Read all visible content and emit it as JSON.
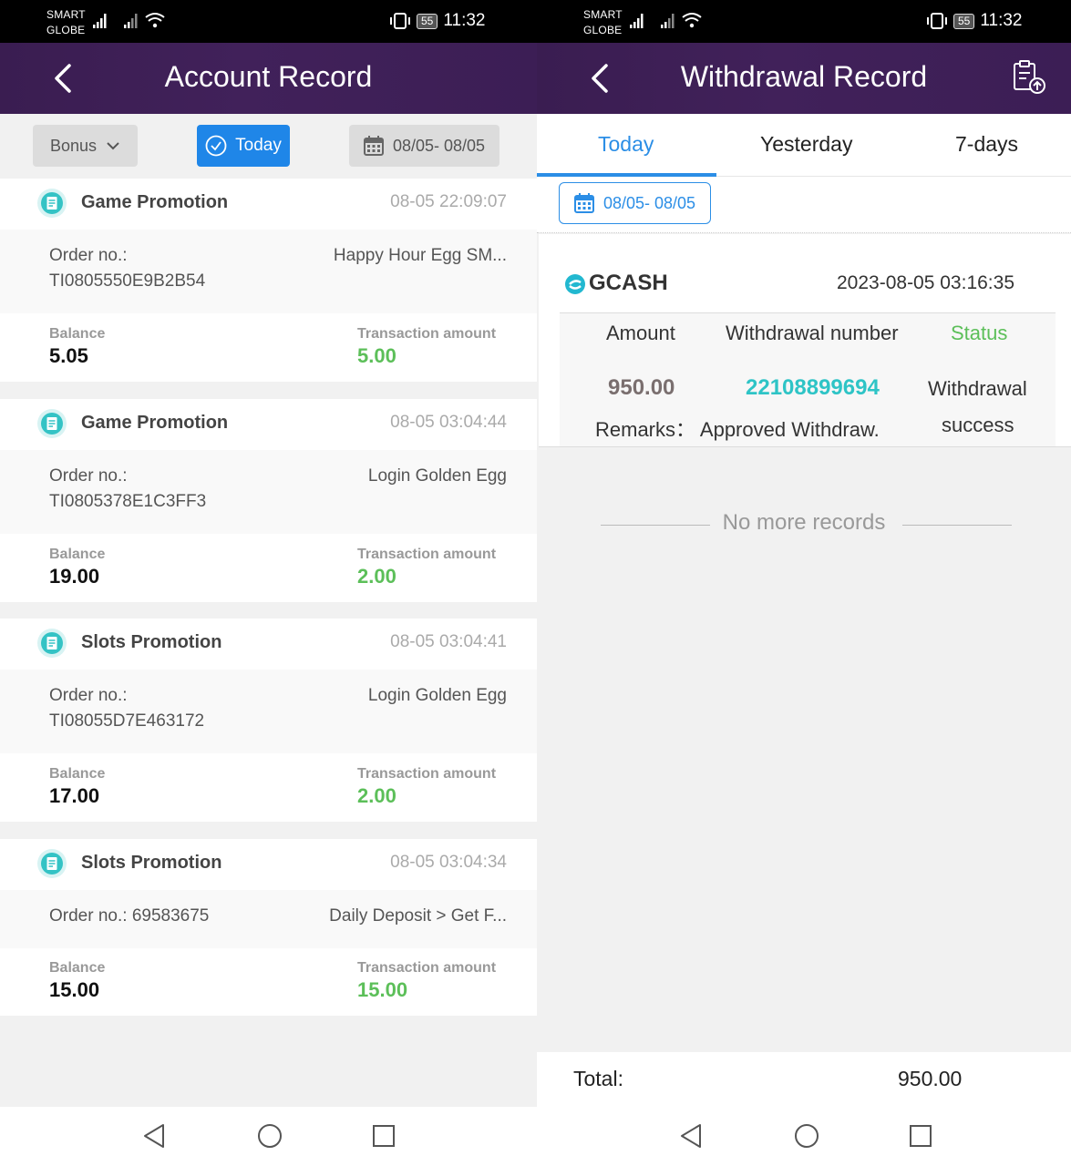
{
  "status_bar": {
    "carrier_line1": "SMART",
    "carrier_line2": "GLOBE",
    "battery": "55",
    "time": "11:32"
  },
  "left": {
    "header_title": "Account Record",
    "filter": {
      "type_label": "Bonus",
      "today_label": "Today",
      "date_range": "08/05- 08/05"
    },
    "records": [
      {
        "title": "Game Promotion",
        "time": "08-05 22:09:07",
        "order_label": "Order no.:",
        "order_no": "TI0805550E9B2B54",
        "description": "Happy Hour Egg SM...",
        "balance_label": "Balance",
        "balance": "5.05",
        "amount_label": "Transaction amount",
        "amount": "5.00"
      },
      {
        "title": "Game Promotion",
        "time": "08-05 03:04:44",
        "order_label": "Order no.:",
        "order_no": "TI0805378E1C3FF3",
        "description": "Login Golden Egg",
        "balance_label": "Balance",
        "balance": "19.00",
        "amount_label": "Transaction amount",
        "amount": "2.00"
      },
      {
        "title": "Slots Promotion",
        "time": "08-05 03:04:41",
        "order_label": "Order no.:",
        "order_no": "TI08055D7E463172",
        "description": "Login Golden Egg",
        "balance_label": "Balance",
        "balance": "17.00",
        "amount_label": "Transaction amount",
        "amount": "2.00"
      },
      {
        "title": "Slots Promotion",
        "time": "08-05 03:04:34",
        "order_label": "Order no.: 69583675",
        "order_no": "",
        "description": "Daily Deposit > Get F...",
        "balance_label": "Balance",
        "balance": "15.00",
        "amount_label": "Transaction amount",
        "amount": "15.00"
      }
    ]
  },
  "right": {
    "header_title": "Withdrawal Record",
    "tabs": [
      "Today",
      "Yesterday",
      "7-days"
    ],
    "date_range": "08/05- 08/05",
    "record": {
      "method": "GCASH",
      "datetime": "2023-08-05 03:16:35",
      "col_amount": "Amount",
      "col_number": "Withdrawal number",
      "col_status": "Status",
      "amount": "950.00",
      "number": "22108899694",
      "status_line1": "Withdrawal",
      "status_line2": "success",
      "remarks": "Remarks： Approved Withdraw."
    },
    "no_more": "No more records",
    "total_label": "Total:",
    "total_value": "950.00"
  },
  "colors": {
    "header_purple": "#3d1f56",
    "accent_blue": "#1f86e8",
    "amount_green": "#5cbf59",
    "number_teal": "#2ec4c6"
  }
}
